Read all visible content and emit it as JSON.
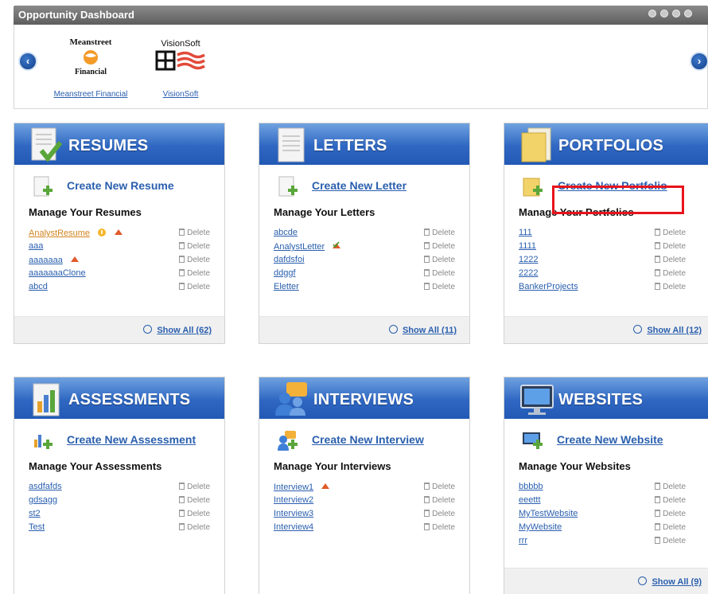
{
  "header": {
    "title": "Opportunity Dashboard"
  },
  "carousel": {
    "prev_icon": "arrow-left-icon",
    "next_icon": "arrow-right-icon",
    "companies": [
      {
        "logo_top": "Meanstreet",
        "logo_bottom": "Financial",
        "link": "Meanstreet Financial"
      },
      {
        "logo_top": "VisionSoft",
        "link": "VisionSoft"
      }
    ]
  },
  "cards": {
    "resumes": {
      "title": "RESUMES",
      "create_label": "Create New Resume",
      "manage_label": "Manage Your Resumes",
      "items": [
        "AnalystResume",
        "aaa",
        "aaaaaaa",
        "aaaaaaaClone",
        "abcd"
      ],
      "show_all": "Show All (62)"
    },
    "letters": {
      "title": "LETTERS",
      "create_label": "Create New Letter",
      "manage_label": "Manage Your Letters",
      "items": [
        "abcde",
        "AnalystLetter",
        "dafdsfoi",
        "ddggf",
        "Eletter"
      ],
      "show_all": "Show All (11)"
    },
    "portfolios": {
      "title": "PORTFOLIOS",
      "create_label": "Create New Portfolio",
      "manage_label": "Manage Your Portfolios",
      "items": [
        "111",
        "1111",
        "1222",
        "2222",
        "BankerProjects"
      ],
      "show_all": "Show All (12)"
    },
    "assessments": {
      "title": "ASSESSMENTS",
      "create_label": "Create New Assessment",
      "manage_label": "Manage Your Assessments",
      "items": [
        "asdfafds",
        "gdsagg",
        "st2",
        "Test"
      ]
    },
    "interviews": {
      "title": "INTERVIEWS",
      "create_label": "Create New Interview",
      "manage_label": "Manage Your Interviews",
      "items": [
        "Interview1",
        "Interview2",
        "Interview3",
        "Interview4"
      ]
    },
    "websites": {
      "title": "WEBSITES",
      "create_label": "Create New Website",
      "manage_label": "Manage Your Websites",
      "items": [
        "bbbbb",
        "eeettt",
        "MyTestWebsite",
        "MyWebsite",
        "rrr"
      ],
      "show_all": "Show All (9)"
    }
  },
  "delete_label": "Delete",
  "colors": {
    "header_blue": "#2f67c2",
    "link_blue": "#2a5fae",
    "highlight_red": "#e8141c",
    "orange_link": "#d28420"
  }
}
